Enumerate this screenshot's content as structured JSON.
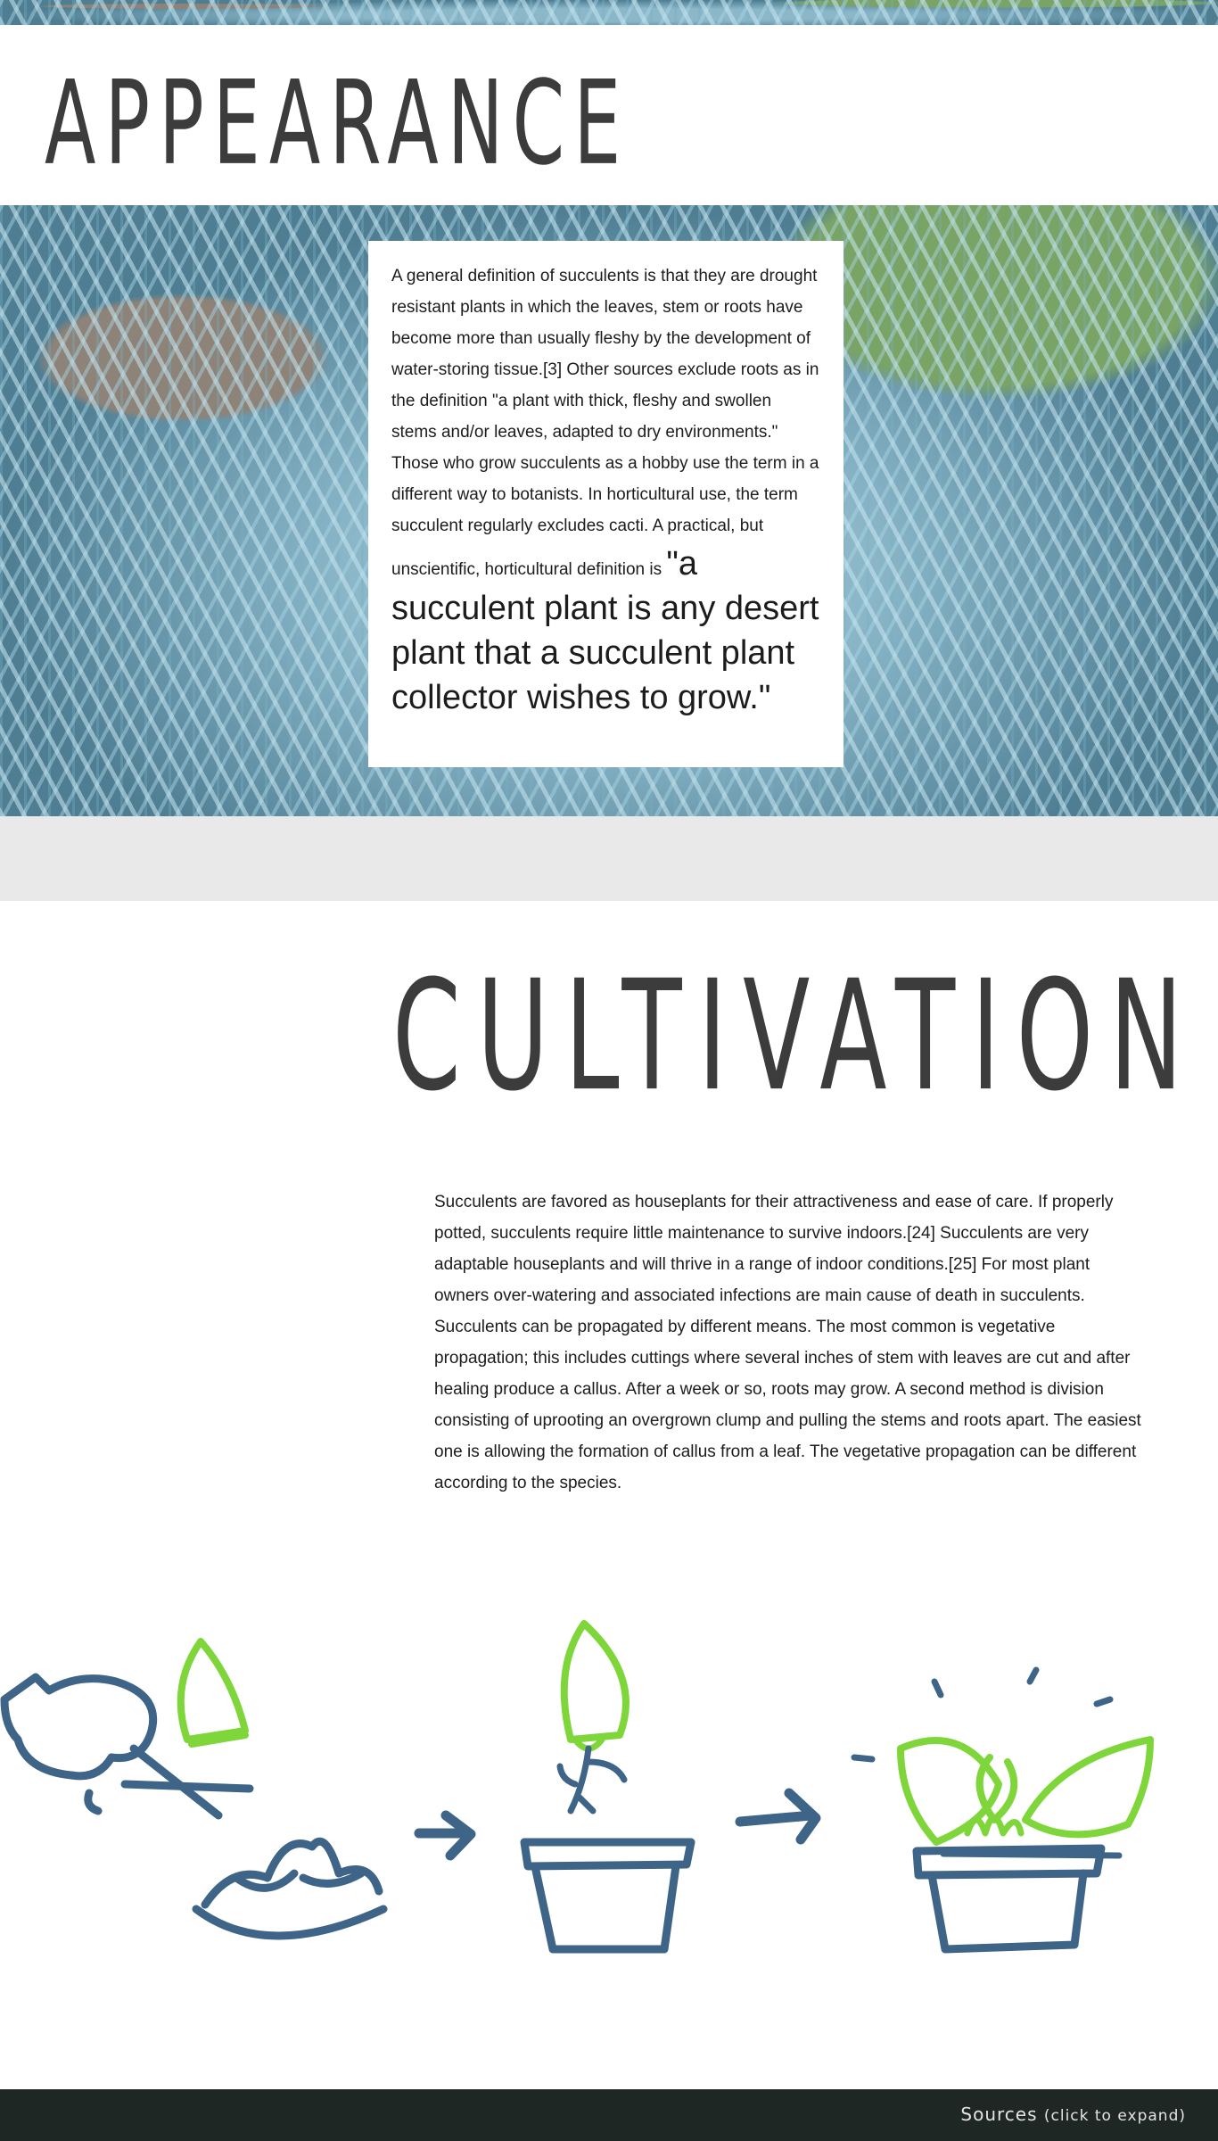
{
  "appearance": {
    "title": "APPEARANCE",
    "definition_text": "A general definition of succulents is that they are drought resistant plants in which the leaves, stem or roots have become more than usually fleshy by the development of water-storing tissue.[3] Other sources exclude roots as in the definition \"a plant with thick, fleshy and swollen stems and/or leaves, adapted to dry environments.\" Those who grow succulents as a hobby use the term in a different way to botanists. In horticultural use, the term succulent regularly excludes cacti. A practical, but unscientific, horticultural definition is ",
    "definition_quote": "\"a succulent plant is any desert plant that a succulent plant collector wishes to grow.\""
  },
  "cultivation": {
    "title": "CULTIVATION",
    "body_text": "Succulents are favored as houseplants for their attractiveness and ease of care. If properly potted, succulents require little maintenance to survive indoors.[24] Succulents are very adaptable houseplants and will thrive in a range of indoor conditions.[25] For most plant owners over-watering and associated infections are main cause of death in succulents. Succulents can be propagated by different means. The most common is vegetative propagation; this includes cuttings where several inches of stem with leaves are cut and after healing produce a callus. After a week or so, roots may grow. A second method is division consisting of uprooting an overgrown clump and pulling the stems and roots apart. The easiest one is allowing the formation of callus from a leaf. The vegetative propagation can be different according to the species."
  },
  "illustration": {
    "icons": [
      "scissors-icon",
      "cut-leaf-icon",
      "succulent-rosette-icon",
      "arrow-right-icon",
      "rooting-leaf-icon",
      "empty-pot-icon",
      "potted-plant-icon"
    ],
    "colors": {
      "stroke_blue": "#3e6488",
      "stroke_green": "#7ed63a"
    }
  },
  "footer": {
    "sources_label": "Sources",
    "sources_hint": "(click to expand)"
  },
  "colors": {
    "title_gray": "#3c3c3c",
    "band_gray": "#e9e9e9",
    "footer_bg": "#1f2724",
    "footer_text": "#e4e4e4"
  }
}
